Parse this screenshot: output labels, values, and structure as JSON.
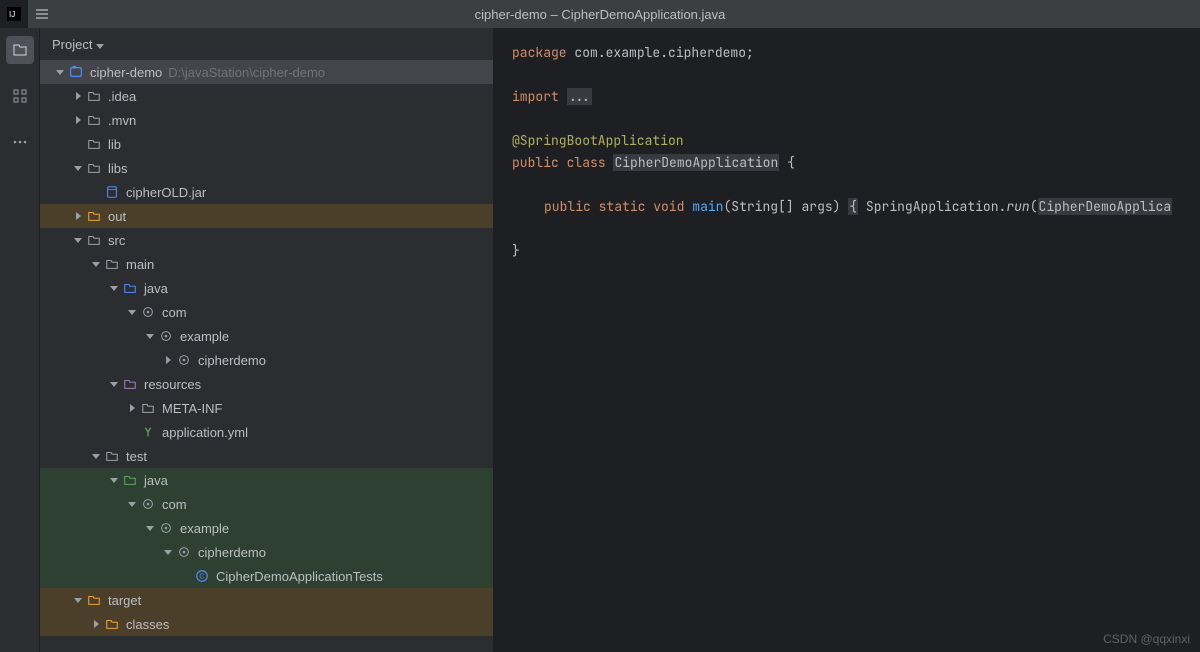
{
  "titlebar": {
    "title": "cipher-demo – CipherDemoApplication.java"
  },
  "sidebar": {
    "header": "Project"
  },
  "toolstrip": {
    "items": [
      "project-icon",
      "structure-icon",
      "more-icon"
    ]
  },
  "tree": [
    {
      "depth": 0,
      "arrow": "down",
      "icon": "module",
      "text": "cipher-demo",
      "path": "D:\\javaStation\\cipher-demo",
      "selected": true
    },
    {
      "depth": 1,
      "arrow": "right",
      "icon": "folder",
      "text": ".idea"
    },
    {
      "depth": 1,
      "arrow": "right",
      "icon": "folder",
      "text": ".mvn"
    },
    {
      "depth": 1,
      "arrow": "none",
      "icon": "folder",
      "text": "lib"
    },
    {
      "depth": 1,
      "arrow": "down",
      "icon": "folder",
      "text": "libs"
    },
    {
      "depth": 2,
      "arrow": "none",
      "icon": "jar",
      "text": "cipherOLD.jar"
    },
    {
      "depth": 1,
      "arrow": "right",
      "icon": "folder",
      "text": "out",
      "style": "hi-orange"
    },
    {
      "depth": 1,
      "arrow": "down",
      "icon": "folder",
      "text": "src"
    },
    {
      "depth": 2,
      "arrow": "down",
      "icon": "folder",
      "text": "main"
    },
    {
      "depth": 3,
      "arrow": "down",
      "icon": "folder-src",
      "text": "java"
    },
    {
      "depth": 4,
      "arrow": "down",
      "icon": "pkg",
      "text": "com"
    },
    {
      "depth": 5,
      "arrow": "down",
      "icon": "pkg",
      "text": "example"
    },
    {
      "depth": 6,
      "arrow": "right",
      "icon": "pkg",
      "text": "cipherdemo"
    },
    {
      "depth": 3,
      "arrow": "down",
      "icon": "folder-res",
      "text": "resources"
    },
    {
      "depth": 4,
      "arrow": "right",
      "icon": "folder",
      "text": "META-INF"
    },
    {
      "depth": 4,
      "arrow": "none",
      "icon": "yml",
      "text": "application.yml"
    },
    {
      "depth": 2,
      "arrow": "down",
      "icon": "folder",
      "text": "test"
    },
    {
      "depth": 3,
      "arrow": "down",
      "icon": "folder-test",
      "text": "java",
      "style": "hi-green"
    },
    {
      "depth": 4,
      "arrow": "down",
      "icon": "pkg",
      "text": "com",
      "style": "hi-green"
    },
    {
      "depth": 5,
      "arrow": "down",
      "icon": "pkg",
      "text": "example",
      "style": "hi-green"
    },
    {
      "depth": 6,
      "arrow": "down",
      "icon": "pkg",
      "text": "cipherdemo",
      "style": "hi-green"
    },
    {
      "depth": 7,
      "arrow": "none",
      "icon": "class",
      "text": "CipherDemoApplicationTests",
      "style": "hi-green"
    },
    {
      "depth": 1,
      "arrow": "down",
      "icon": "folder",
      "text": "target",
      "style": "hi-orange"
    },
    {
      "depth": 2,
      "arrow": "right",
      "icon": "folder",
      "text": "classes",
      "style": "hi-orange"
    }
  ],
  "code": {
    "package_kw": "package",
    "package_name": "com.example.cipherdemo;",
    "import_kw": "import",
    "import_ellipsis": "...",
    "annotation": "@SpringBootApplication",
    "public": "public",
    "class": "class",
    "class_name": "CipherDemoApplication",
    "open_brace": "{",
    "static": "static",
    "void": "void",
    "main": "main",
    "params": "(String[] args)",
    "open_brace2": "{",
    "spring_app": "SpringApplication.",
    "run": "run",
    "run_arg": "(CipherDemoApplica",
    "close_brace": "}"
  },
  "watermark": "CSDN @qqxinxi"
}
